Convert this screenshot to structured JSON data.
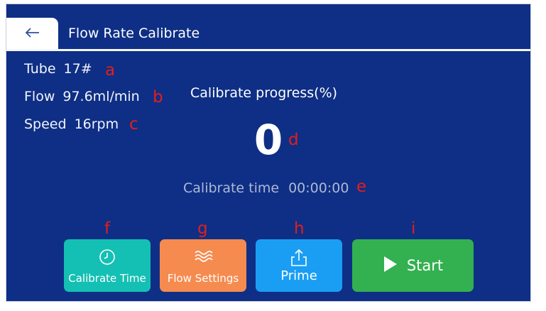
{
  "header": {
    "title": "Flow Rate Calibrate",
    "back_icon": "arrow-left-icon"
  },
  "info": {
    "tube_label": "Tube",
    "tube_value": "17#",
    "flow_label": "Flow",
    "flow_value": "97.6ml/min",
    "speed_label": "Speed",
    "speed_value": "16rpm"
  },
  "progress": {
    "title": "Calibrate progress(%)",
    "value": "0"
  },
  "calibrate_time": {
    "label": "Calibrate time",
    "value": "00:00:00"
  },
  "buttons": {
    "calibrate_time": {
      "label": "Calibrate Time",
      "icon": "clock-icon"
    },
    "flow_settings": {
      "label": "Flow Settings",
      "icon": "waves-icon"
    },
    "prime": {
      "label": "Prime",
      "icon": "upload-icon"
    },
    "start": {
      "label": "Start",
      "icon": "play-icon"
    }
  },
  "markers": {
    "a": "a",
    "b": "b",
    "c": "c",
    "d": "d",
    "e": "e",
    "f": "f",
    "g": "g",
    "h": "h",
    "i": "i"
  },
  "colors": {
    "screen_bg": "#0e2f85",
    "calibrate_time_btn": "#14c0b3",
    "flow_settings_btn": "#f68b4f",
    "prime_btn": "#1a9ef4",
    "start_btn": "#33b04f",
    "marker": "#e51d1d"
  }
}
